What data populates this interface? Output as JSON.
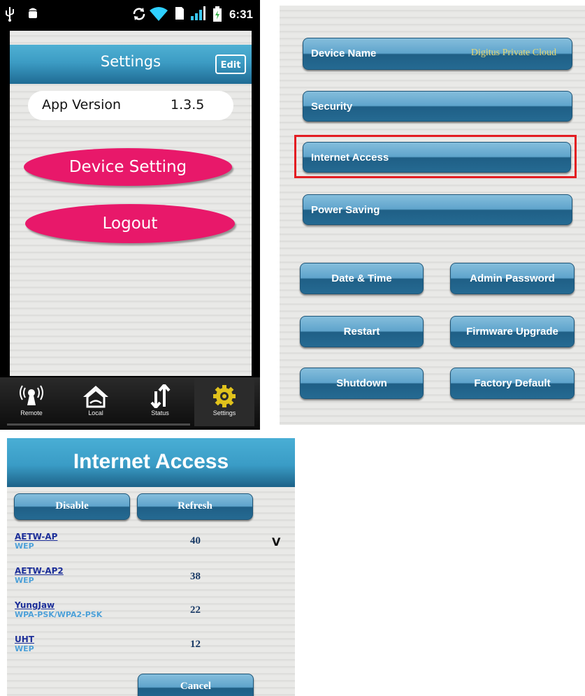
{
  "phone": {
    "status_bar": {
      "left_icons": [
        "usb-icon",
        "android-debug-icon"
      ],
      "right_icons": [
        "sync-icon",
        "wifi-icon",
        "sim-icon",
        "signal-icon",
        "battery-icon"
      ],
      "time": "6:31"
    },
    "header": {
      "title": "Settings",
      "edit_label": "Edit"
    },
    "app_version": {
      "label": "App Version",
      "value": "1.3.5"
    },
    "buttons": {
      "device_setting": "Device Setting",
      "logout": "Logout"
    },
    "tabs": [
      {
        "label": "Remote",
        "icon": "remote-antenna-icon"
      },
      {
        "label": "Local",
        "icon": "house-icon"
      },
      {
        "label": "Status",
        "icon": "up-down-arrows-icon"
      },
      {
        "label": "Settings",
        "icon": "gear-icon"
      }
    ],
    "colors": {
      "header": "#3c9cc4",
      "pink_button": "#e8186a"
    }
  },
  "device_settings": {
    "device_name_label": "Device Name",
    "device_name_value": "Digitus Private Cloud",
    "security": "Security",
    "internet_access": "Internet Access",
    "power_saving": "Power Saving",
    "date_time": "Date & Time",
    "admin_password": "Admin Password",
    "restart": "Restart",
    "firmware_upgrade": "Firmware Upgrade",
    "shutdown": "Shutdown",
    "factory_default": "Factory Default",
    "highlight_color": "#e31d22"
  },
  "internet_access": {
    "title": "Internet Access",
    "disable": "Disable",
    "refresh": "Refresh",
    "cancel": "Cancel",
    "selected_mark": "V",
    "networks": [
      {
        "ssid": "AETW-AP",
        "security": "WEP",
        "signal": "40"
      },
      {
        "ssid": "AETW-AP2",
        "security": "WEP",
        "signal": "38"
      },
      {
        "ssid": "YungJaw",
        "security": "WPA-PSK/WPA2-PSK",
        "signal": "22"
      },
      {
        "ssid": "UHT",
        "security": "WEP",
        "signal": "12"
      }
    ]
  }
}
